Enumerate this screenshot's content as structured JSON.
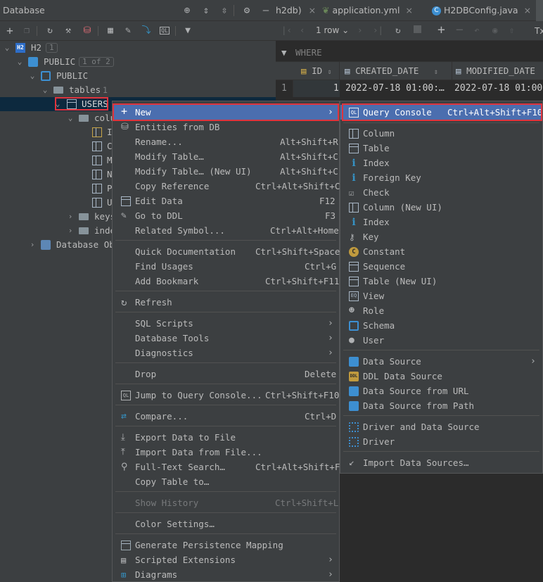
{
  "panel": {
    "title": "Database",
    "header_icons": [
      "crosshair-icon",
      "expand-all-icon",
      "collapse-all-icon",
      "gear-icon",
      "minimize-icon"
    ],
    "toolbar_icons": [
      "add-icon",
      "copy-icon",
      "refresh-icon",
      "schema-settings-icon",
      "datasource-properties-icon",
      "table-view-icon",
      "edit-icon",
      "jump-icon",
      "query-console-icon",
      "filter-icon"
    ]
  },
  "tree": {
    "h2": {
      "label": "H2",
      "badge": "1"
    },
    "public_db": {
      "label": "PUBLIC",
      "badge": "1 of 2"
    },
    "public_schema": {
      "label": "PUBLIC"
    },
    "tables": {
      "label": "tables",
      "count": "1"
    },
    "users": {
      "label": "USERS"
    },
    "columns": {
      "label": "colu"
    },
    "col_items": [
      "I",
      "C",
      "M",
      "N",
      "P",
      "U"
    ],
    "keys": {
      "label": "keys"
    },
    "indexes": {
      "label": "inde"
    },
    "database_objects": {
      "label": "Database Obj"
    }
  },
  "editor": {
    "tabs": [
      {
        "label": "h2db)",
        "icon": ""
      },
      {
        "label": "application.yml",
        "icon": "spring-leaf-icon"
      },
      {
        "label": "H2DBConfig.java",
        "icon": "java-class-icon"
      }
    ],
    "rows_label": "1 row",
    "tx_label": "Tx",
    "where_label": "WHERE",
    "columns": [
      "ID",
      "CREATED_DATE",
      "MODIFIED_DATE"
    ],
    "row_number": "1",
    "row": [
      "1",
      "2022-07-18 01:00:…",
      "2022-07-18 01:00"
    ]
  },
  "context_menu": {
    "items": [
      {
        "label": "New",
        "submenu": true,
        "icon": "plus-icon"
      },
      {
        "label": "Entities from DB",
        "icon": "entities-icon"
      },
      {
        "label": "Rename...",
        "shortcut": "Alt+Shift+R"
      },
      {
        "label": "Modify Table…",
        "shortcut": "Alt+Shift+C"
      },
      {
        "label": "Modify Table… (New UI)",
        "shortcut": "Alt+Shift+C"
      },
      {
        "label": "Copy Reference",
        "shortcut": "Ctrl+Alt+Shift+C"
      },
      {
        "label": "Edit Data",
        "shortcut": "F12",
        "icon": "table-icon"
      },
      {
        "label": "Go to DDL",
        "shortcut": "F3",
        "icon": "pencil-icon"
      },
      {
        "label": "Related Symbol...",
        "shortcut": "Ctrl+Alt+Home"
      },
      {
        "label": "Quick Documentation",
        "shortcut": "Ctrl+Shift+Space"
      },
      {
        "label": "Find Usages",
        "shortcut": "Ctrl+G"
      },
      {
        "label": "Add Bookmark",
        "shortcut": "Ctrl+Shift+F11"
      },
      {
        "label": "Refresh",
        "icon": "refresh-icon"
      },
      {
        "label": "SQL Scripts",
        "submenu": true
      },
      {
        "label": "Database Tools",
        "submenu": true
      },
      {
        "label": "Diagnostics",
        "submenu": true
      },
      {
        "label": "Drop",
        "shortcut": "Delete"
      },
      {
        "label": "Jump to Query Console...",
        "shortcut": "Ctrl+Shift+F10",
        "icon": "query-console-icon"
      },
      {
        "label": "Compare...",
        "shortcut": "Ctrl+D",
        "icon": "compare-icon"
      },
      {
        "label": "Export Data to File",
        "icon": "export-icon"
      },
      {
        "label": "Import Data from File...",
        "icon": "import-icon"
      },
      {
        "label": "Full-Text Search…",
        "shortcut": "Ctrl+Alt+Shift+F",
        "icon": "search-icon"
      },
      {
        "label": "Copy Table to…"
      },
      {
        "label": "Show History",
        "shortcut": "Ctrl+Shift+L",
        "disabled": true
      },
      {
        "label": "Color Settings…"
      },
      {
        "label": "Generate Persistence Mapping",
        "icon": "persistence-icon"
      },
      {
        "label": "Scripted Extensions",
        "submenu": true,
        "icon": "scripted-extensions-icon"
      },
      {
        "label": "Diagrams",
        "submenu": true,
        "icon": "diagrams-icon"
      }
    ]
  },
  "submenu": {
    "items": [
      {
        "label": "Query Console",
        "shortcut": "Ctrl+Alt+Shift+F10",
        "icon": "query-console-icon"
      },
      {
        "label": "Column",
        "icon": "column-icon"
      },
      {
        "label": "Table",
        "icon": "table-icon"
      },
      {
        "label": "Index",
        "icon": "index-icon"
      },
      {
        "label": "Foreign Key",
        "icon": "foreign-key-icon"
      },
      {
        "label": "Check",
        "icon": "check-icon"
      },
      {
        "label": "Column (New UI)",
        "icon": "column-icon"
      },
      {
        "label": "Index",
        "icon": "index-icon"
      },
      {
        "label": "Key",
        "icon": "key-icon"
      },
      {
        "label": "Constant",
        "icon": "constant-icon"
      },
      {
        "label": "Sequence",
        "icon": "sequence-icon"
      },
      {
        "label": "Table (New UI)",
        "icon": "table-icon"
      },
      {
        "label": "View",
        "icon": "view-icon"
      },
      {
        "label": "Role",
        "icon": "role-icon"
      },
      {
        "label": "Schema",
        "icon": "schema-icon"
      },
      {
        "label": "User",
        "icon": "user-icon"
      },
      {
        "label": "Data Source",
        "submenu": true,
        "icon": "data-source-icon"
      },
      {
        "label": "DDL Data Source",
        "icon": "ddl-icon"
      },
      {
        "label": "Data Source from URL",
        "icon": "data-source-url-icon"
      },
      {
        "label": "Data Source from Path",
        "icon": "data-source-path-icon"
      },
      {
        "label": "Driver and Data Source",
        "icon": "driver-icon"
      },
      {
        "label": "Driver",
        "icon": "driver-icon"
      },
      {
        "label": "Import Data Sources…",
        "icon": "import-data-sources-icon"
      }
    ]
  },
  "colors": {
    "highlight": "#4b6eaf",
    "annotation_red": "#e0333c",
    "panel_bg": "#3c3f41",
    "editor_bg": "#2b2b2b"
  }
}
